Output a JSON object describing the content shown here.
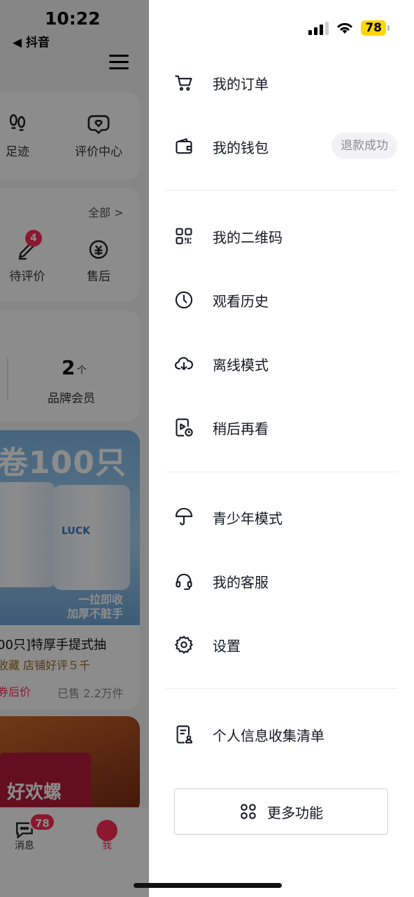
{
  "background": {
    "time": "10:22",
    "back_label": "◀ 抖音",
    "shortcuts": [
      {
        "label": "足迹",
        "icon": "footprints-icon"
      },
      {
        "label": "评价中心",
        "icon": "review-heart-icon"
      }
    ],
    "orders": {
      "all_label": "全部 >",
      "items": [
        {
          "label": "待评价",
          "icon": "pen-icon",
          "badge": "4"
        },
        {
          "label": "售后",
          "icon": "refund-icon"
        }
      ]
    },
    "brand": {
      "number": "2",
      "unit": "个",
      "label": "品牌会员"
    },
    "product": {
      "banner_text": "卷100只",
      "can_label": "LUCK",
      "slogan_line1": "一拉即收",
      "slogan_line2": "加厚不脏手",
      "name": "00只]特厚手提式抽",
      "tags": "收藏  店铺好评５千",
      "price_label": "券后价",
      "sold": "已售 2.2万件"
    },
    "product2_text": "好欢螺",
    "tabbar": {
      "messages_label": "消息",
      "messages_badge": "78",
      "me_label": "我"
    }
  },
  "status_bar": {
    "battery": "78"
  },
  "drawer": {
    "group1": [
      {
        "label": "我的订单",
        "icon": "cart-icon"
      },
      {
        "label": "我的钱包",
        "icon": "wallet-icon",
        "badge": "退款成功"
      }
    ],
    "group2": [
      {
        "label": "我的二维码",
        "icon": "qr-code-icon"
      },
      {
        "label": "观看历史",
        "icon": "clock-icon"
      },
      {
        "label": "离线模式",
        "icon": "cloud-download-icon"
      },
      {
        "label": "稍后再看",
        "icon": "watch-later-icon"
      }
    ],
    "group3": [
      {
        "label": "青少年模式",
        "icon": "umbrella-icon"
      },
      {
        "label": "我的客服",
        "icon": "headset-icon"
      },
      {
        "label": "设置",
        "icon": "settings-gear-icon"
      }
    ],
    "group4": [
      {
        "label": "个人信息收集清单",
        "icon": "personal-info-doc-icon"
      }
    ],
    "more_button": {
      "label": "更多功能",
      "icon": "grid-icon"
    }
  },
  "colors": {
    "accent": "#fe2c55",
    "battery": "#ffd60a",
    "text": "#161823",
    "muted": "#8a8b91"
  }
}
